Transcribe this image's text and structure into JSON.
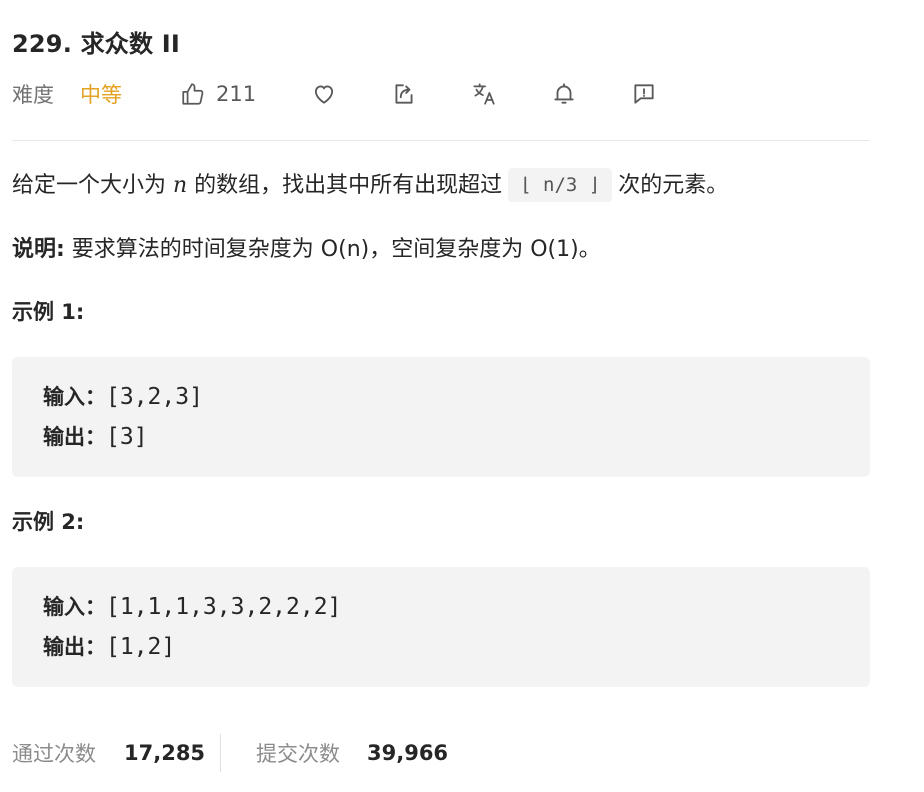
{
  "problem": {
    "title": "229. 求众数 II"
  },
  "meta": {
    "difficulty_label": "难度",
    "difficulty_value": "中等",
    "difficulty_color": "#e3a221",
    "likes": "211",
    "icons": [
      "thumbs-up-icon",
      "heart-icon",
      "share-icon",
      "translate-icon",
      "bell-icon",
      "feedback-icon"
    ]
  },
  "description": {
    "line1_before": "给定一个大小为 ",
    "line1_var": "n",
    "line1_middle": " 的数组，找出其中所有出现超过",
    "line1_code": "⌊ n/3 ⌋",
    "line1_after": "次的元素。",
    "note_label": "说明:",
    "note_text": " 要求算法的时间复杂度为 O(n)，空间复杂度为 O(1)。"
  },
  "examples": [
    {
      "heading": "示例 1:",
      "input_label": "输入：",
      "input_value": "[3,2,3]",
      "output_label": "输出：",
      "output_value": "[3]"
    },
    {
      "heading": "示例 2:",
      "input_label": "输入：",
      "input_value": "[1,1,1,3,3,2,2,2]",
      "output_label": "输出：",
      "output_value": "[1,2]"
    }
  ],
  "stats": {
    "accepted_label": "通过次数",
    "accepted_value": "17,285",
    "submitted_label": "提交次数",
    "submitted_value": "39,966"
  }
}
